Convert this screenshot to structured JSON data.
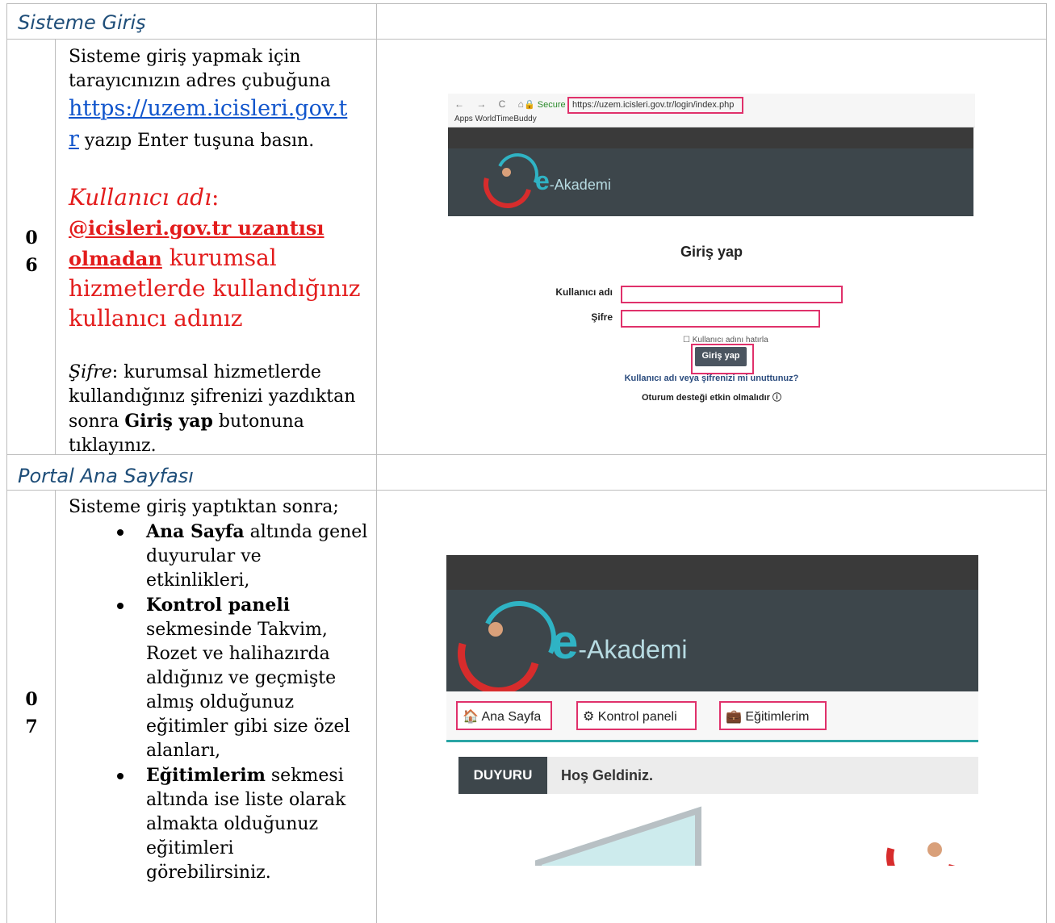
{
  "sections": [
    {
      "title": "Sisteme Giriş"
    },
    {
      "title": "Portal Ana Sayfası"
    }
  ],
  "row6": {
    "number": "0\n6",
    "num_a": "0",
    "num_b": "6",
    "line1": "Sisteme giriş yapmak için",
    "line2": "tarayıcınızın adres çubuğuna",
    "link_a": "https://uzem.icisleri.gov.t",
    "link_b": "r",
    "after_link": " yazıp Enter tuşuna basın.",
    "user_label": "Kullanıcı adı",
    "user_colon": ":",
    "user_bold_1": "@icisleri.gov.tr uzantısı ",
    "user_bold_2": "olmadan",
    "user_rest_1": " kurumsal",
    "user_rest_2": "hizmetlerde kullandığınız",
    "user_rest_3": "kullanıcı adınız",
    "pw_label": "Şifre",
    "pw_l1": ": kurumsal hizmetlerde",
    "pw_l2": "kullandığınız şifrenizi yazdıktan",
    "pw_l3a": "sonra ",
    "pw_l3b": "Giriş yap",
    "pw_l3c": " butonuna",
    "pw_l4": "tıklayınız."
  },
  "row7": {
    "num_a": "0",
    "num_b": "7",
    "intro": "Sisteme giriş yaptıktan sonra;",
    "b1_bold": "Ana Sayfa",
    "b1_l1": " altında genel",
    "b1_l2": "duyurular ve",
    "b1_l3": "etkinlikleri,",
    "b2_bold": "Kontrol paneli",
    "b2_l1": "sekmesinde Takvim,",
    "b2_l2": "Rozet ve halihazırda",
    "b2_l3": "aldığınız ve geçmişte",
    "b2_l4": "almış olduğunuz",
    "b2_l5": "eğitimler gibi size özel",
    "b2_l6": "alanları,",
    "b3_bold": "Eğitimlerim",
    "b3_l1": " sekmesi",
    "b3_l2": "altında ise liste olarak",
    "b3_l3": "almakta olduğunuz",
    "b3_l4": "eğitimleri",
    "b3_l5": "görebilirsiniz."
  },
  "shot1": {
    "nav": "← → C ⌂",
    "secure": "🔒 Secure",
    "url": "https://uzem.icisleri.gov.tr/login/index.php",
    "bookmarks": "Apps   WorldTimeBuddy",
    "brand_e": "e",
    "brand_rest": "-Akademi",
    "title": "Giriş yap",
    "user_label": "Kullanıcı adı",
    "pw_label": "Şifre",
    "remember": "☐ Kullanıcı adını hatırla",
    "button": "Giriş yap",
    "forgot": "Kullanıcı adı veya şifrenizi mi unuttunuz?",
    "cookies": "Oturum desteği etkin olmalıdır ⓘ"
  },
  "shot2": {
    "brand_e": "e",
    "brand_rest": "-Akademi",
    "tab1": "🏠  Ana Sayfa",
    "tab2": "⚙  Kontrol paneli",
    "tab3": "💼  Eğitimlerim",
    "ann_label": "DUYURU",
    "ann_text": "Hoş Geldiniz."
  }
}
